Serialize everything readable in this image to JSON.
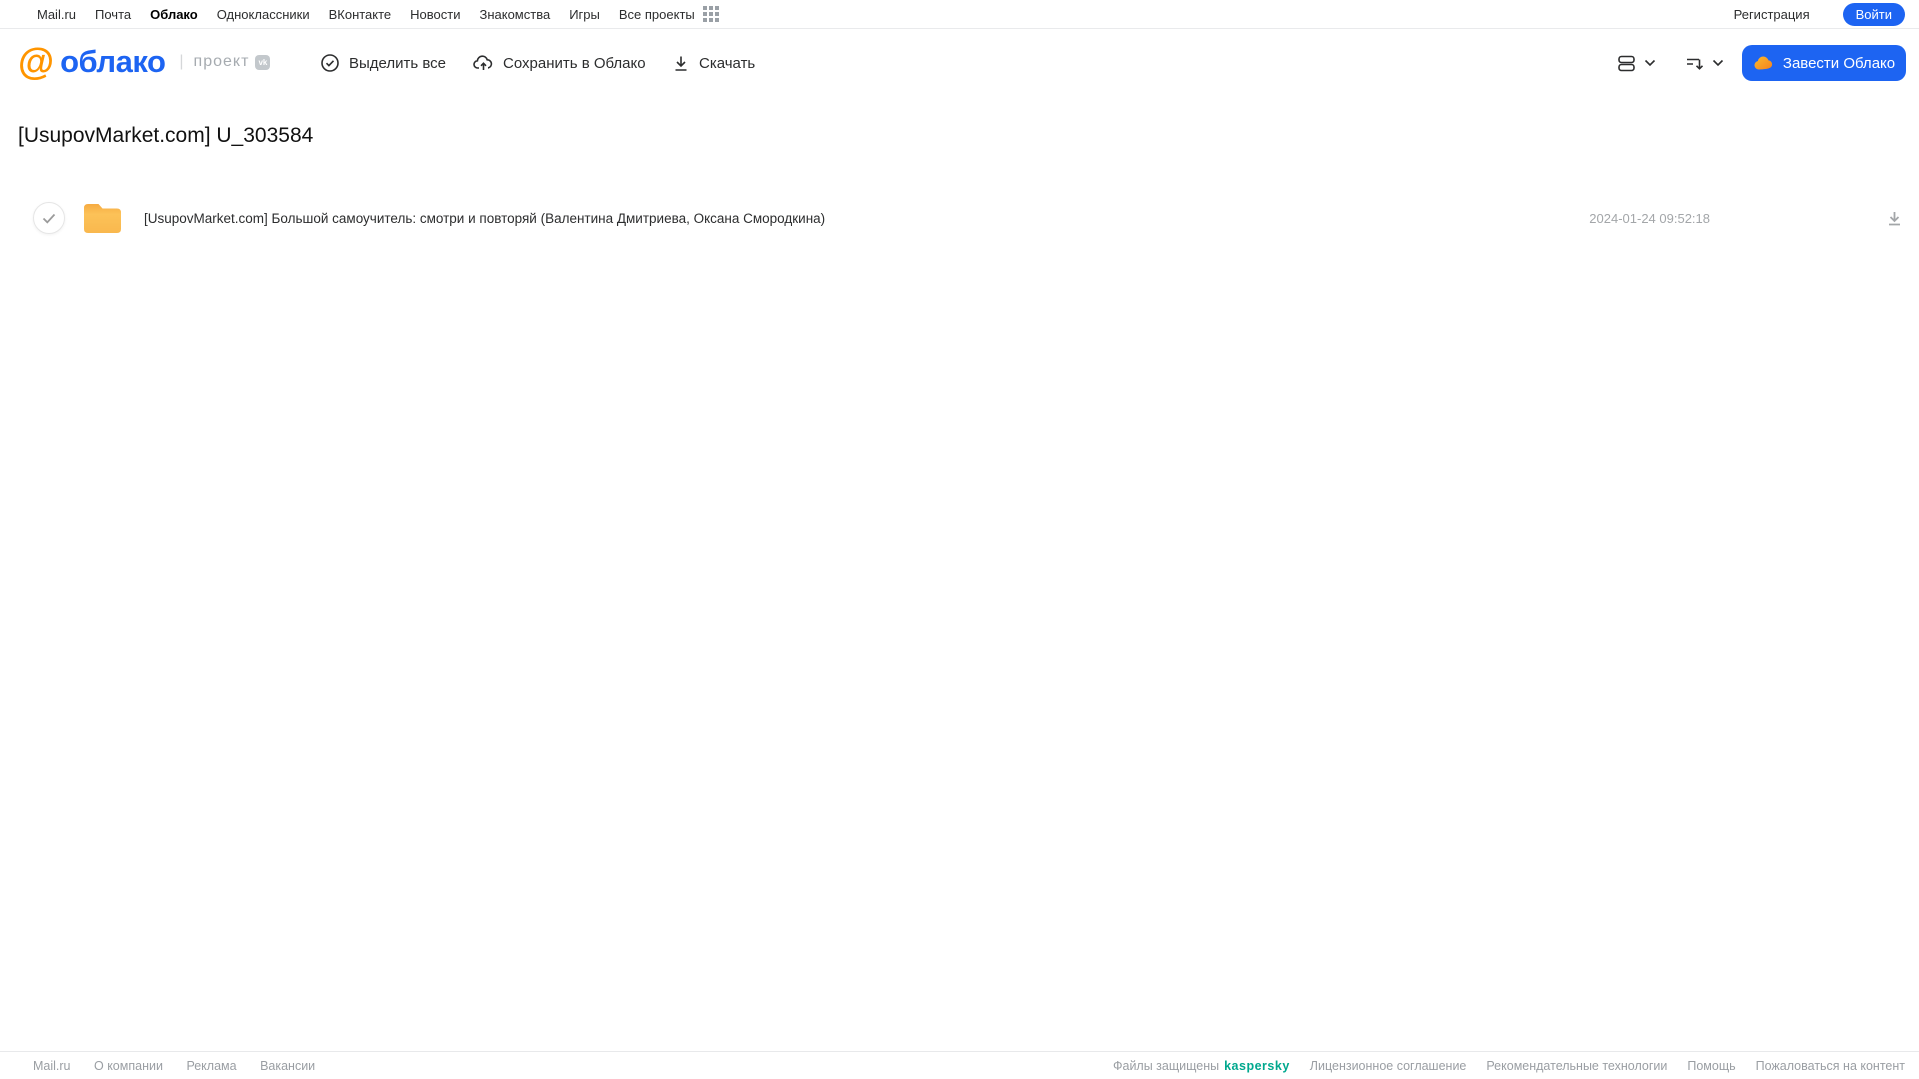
{
  "topbar": {
    "links": [
      "Mail.ru",
      "Почта",
      "Облако",
      "Одноклассники",
      "ВКонтакте",
      "Новости",
      "Знакомства",
      "Игры",
      "Все проекты"
    ],
    "active_link": "Облако",
    "register_label": "Регистрация",
    "login_label": "Войти"
  },
  "header": {
    "logo_at": "@",
    "logo_text": "облако",
    "logo_separator": "|",
    "project_label": "проект",
    "vk_badge": "vk",
    "toolbar": {
      "select_all_label": "Выделить все",
      "save_to_cloud_label": "Сохранить в Облако",
      "download_label": "Скачать"
    },
    "get_cloud_label": "Завести Облако"
  },
  "content": {
    "title": "[UsupovMarket.com] U_303584",
    "files": [
      {
        "type": "folder",
        "name": "[UsupovMarket.com] Большой самоучитель: смотри и повторяй (Валентина Дмитриева, Оксана Смородкина)",
        "date": "2024-01-24 09:52:18"
      }
    ]
  },
  "footer": {
    "left_links": [
      "Mail.ru",
      "О компании",
      "Реклама",
      "Вакансии"
    ],
    "protected_label": "Файлы защищены",
    "kaspersky_label": "kaspersky",
    "right_links": [
      "Лицензионное соглашение",
      "Рекомендательные технологии",
      "Помощь",
      "Пожаловаться на контент"
    ]
  },
  "colors": {
    "accent_blue": "#1d64f2",
    "logo_orange": "#ff9500",
    "folder_yellow": "#fbbf50",
    "kaspersky_green": "#00a88e",
    "muted_gray": "#a3a6a9"
  }
}
